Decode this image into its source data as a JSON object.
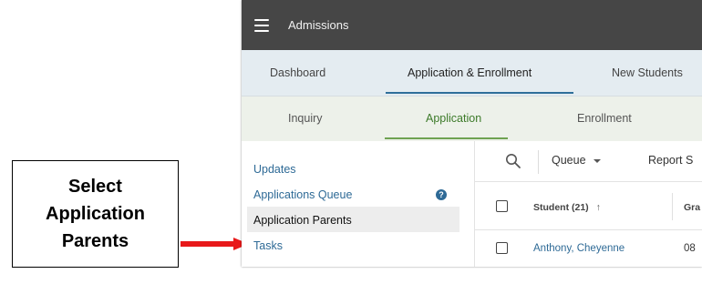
{
  "callout": {
    "lines": [
      "Select",
      "Application",
      "Parents"
    ]
  },
  "app": {
    "title": "Admissions"
  },
  "primary_tabs": [
    {
      "label": "Dashboard"
    },
    {
      "label": "Application & Enrollment",
      "active": true
    },
    {
      "label": "New Students"
    }
  ],
  "secondary_tabs": [
    {
      "label": "Inquiry"
    },
    {
      "label": "Application",
      "active": true
    },
    {
      "label": "Enrollment"
    }
  ],
  "sidebar": {
    "items": [
      {
        "label": "Updates"
      },
      {
        "label": "Applications Queue",
        "icon": "help-icon",
        "icon_text": "?"
      },
      {
        "label": "Application Parents",
        "selected": true
      },
      {
        "label": "Tasks"
      }
    ]
  },
  "toolbar": {
    "search_icon": "search-icon",
    "queue_label": "Queue",
    "report_label": "Report S"
  },
  "table": {
    "columns": [
      {
        "label": "Student (21)",
        "sort": "↑"
      },
      {
        "label": "Gra"
      }
    ],
    "rows": [
      {
        "student": "Anthony, Cheyenne",
        "grade": "08"
      }
    ]
  },
  "colors": {
    "topbar": "#464646",
    "primary_tab_bg": "#e4ecf1",
    "secondary_tab_bg": "#edf1ea",
    "active_secondary": "#3c7a29",
    "link": "#2e6a96",
    "callout_arrow": "#e8191a"
  }
}
